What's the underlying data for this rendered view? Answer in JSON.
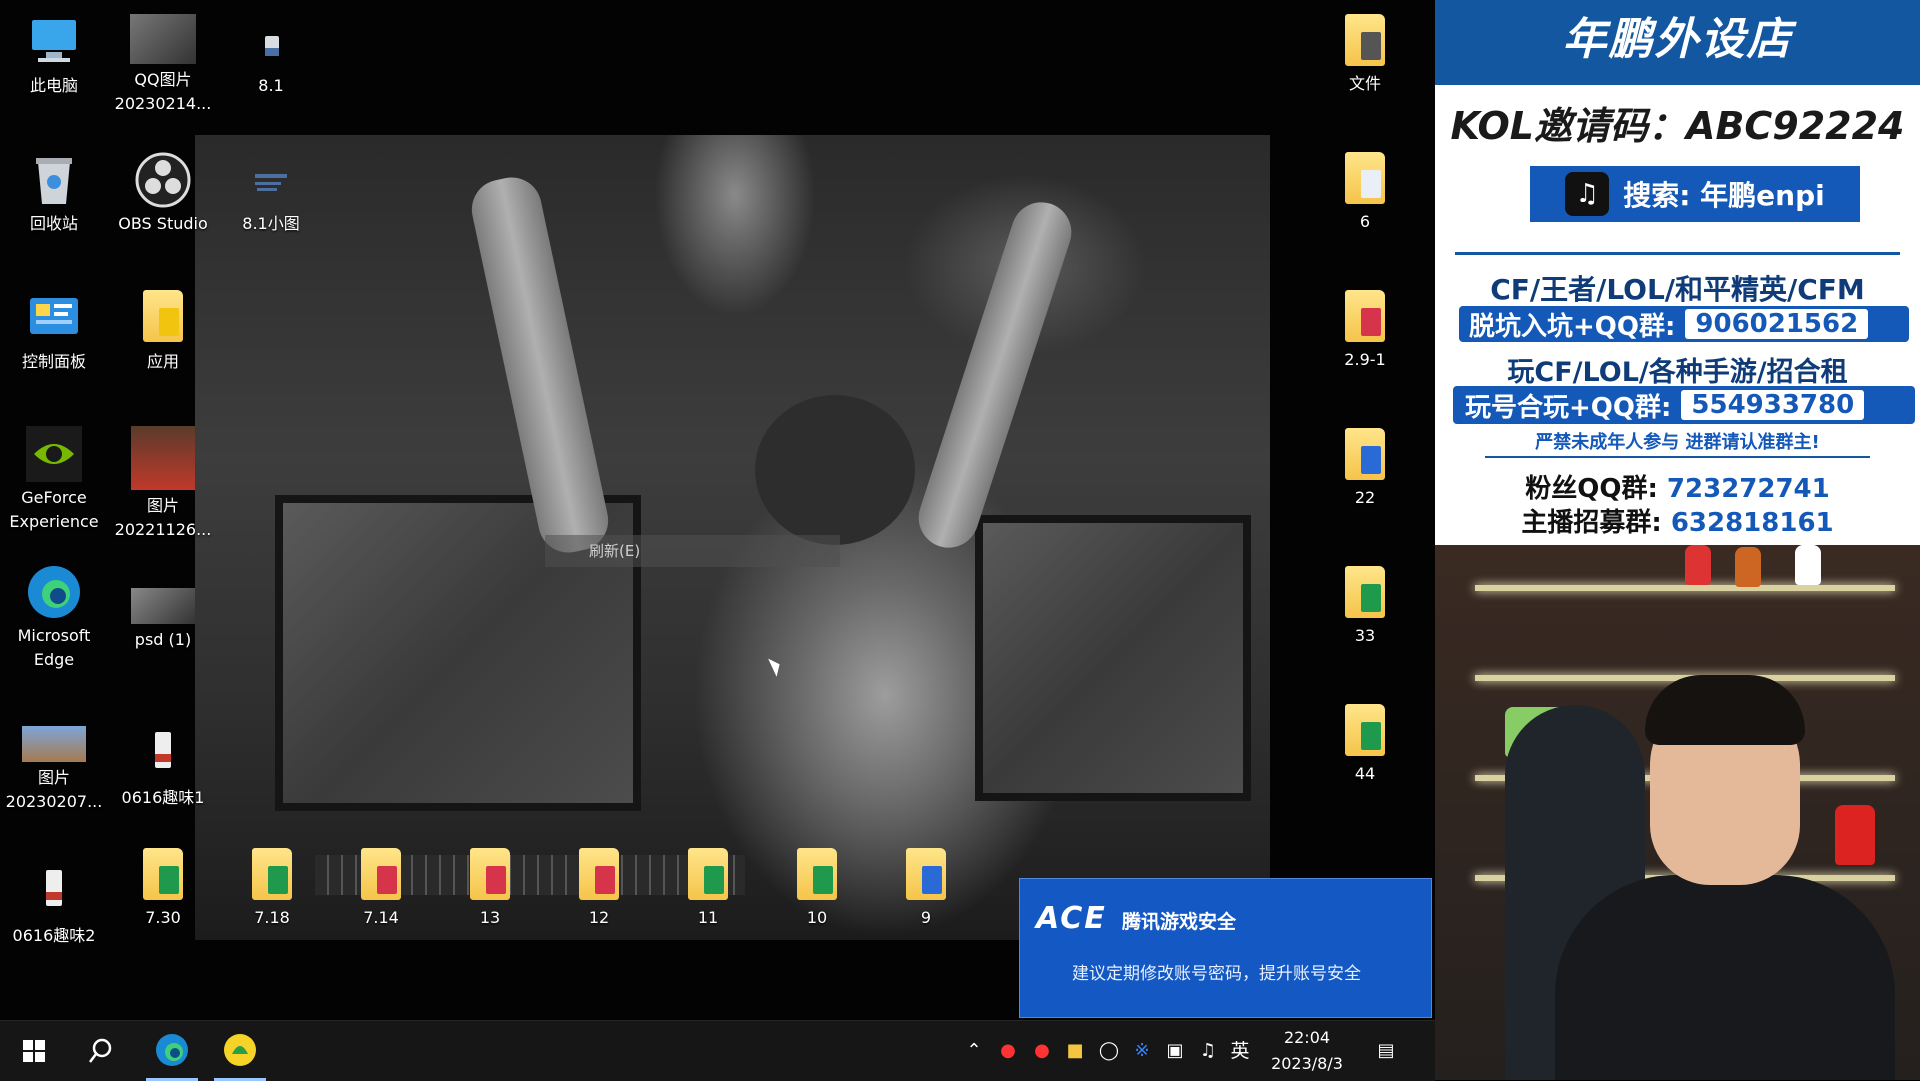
{
  "desktop": {
    "icons": {
      "this_pc": "此电脑",
      "qq_image_1": "QQ图片\n20230214...",
      "file_8_1": "8.1",
      "recycle_bin": "回收站",
      "obs": "OBS Studio",
      "small_img": "8.1小图",
      "control_panel": "控制面板",
      "app": "应用",
      "geforce": "GeForce\nExperience",
      "img_20221126": "图片\n20221126...",
      "edge": "Microsoft\nEdge",
      "psd": "psd (1)",
      "img_20230207": "图片\n20230207...",
      "fun1": "0616趣味1",
      "fun2": "0616趣味2",
      "f_730": "7.30",
      "f_718": "7.18",
      "f_714": "7.14",
      "f_13": "13",
      "f_12": "12",
      "f_11": "11",
      "f_10": "10",
      "f_9": "9",
      "r_files": "文件",
      "r_6": "6",
      "r_291": "2.9-1",
      "r_22": "22",
      "r_33": "33",
      "r_44": "44"
    },
    "context_menu": {
      "refresh": "刷新(E)"
    }
  },
  "notification": {
    "brand": "ACE",
    "title": "腾讯游戏安全",
    "message": "建议定期修改账号密码，提升账号安全"
  },
  "taskbar": {
    "ime": "英",
    "time": "22:04",
    "date": "2023/8/3"
  },
  "overlay": {
    "banner": "年鹏外设店",
    "kol_label": "KOL邀请码：",
    "kol_code": "ABC92224",
    "douyin_search": "搜索: 年鹏enpi",
    "games_line": "CF/王者/LOL/和平精英/CFM",
    "group1_label": "脱坑入坑+QQ群:",
    "group1_num": "906021562",
    "rent_line": "玩CF/LOL/各种手游/招合租",
    "group2_label": "玩号合玩+QQ群:",
    "group2_num": "554933780",
    "warning": "严禁未成年人参与  进群请认准群主!",
    "fans_label": "粉丝QQ群:",
    "fans_num": "723272741",
    "recruit_label": "主播招募群:",
    "recruit_num": "632818161"
  }
}
